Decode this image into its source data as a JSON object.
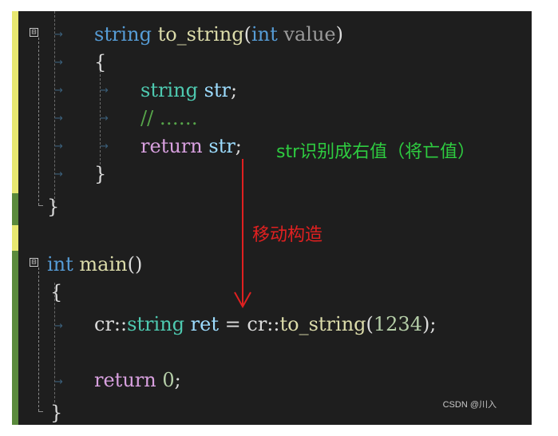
{
  "code_lines": {
    "l1": {
      "kw_string": "string",
      "fn_name": "to_string",
      "lparen": "(",
      "kw_int": "int",
      "param": "value",
      "rparen": ")"
    },
    "l2": {
      "text": "{"
    },
    "l3": {
      "kw_string": "string",
      "var": "str",
      "semi": ";"
    },
    "l4": {
      "comment": "// ……"
    },
    "l5": {
      "kw_return": "return",
      "var": "str",
      "semi": ";"
    },
    "l6": {
      "text": "}"
    },
    "l7": {
      "text": "}"
    },
    "l8": {
      "kw_int": "int",
      "fn_name": "main",
      "parens": "()"
    },
    "l9": {
      "text": "{"
    },
    "l10": {
      "ns1": "cr::",
      "type": "string",
      "var": "ret",
      "eq": "=",
      "ns2": "cr::",
      "fn_name": "to_string",
      "lparen": "(",
      "num": "1234",
      "rparen": ")",
      "semi": ";"
    },
    "l11": {
      "kw_return": "return",
      "num": "0",
      "semi": ";"
    },
    "l12": {
      "text": "}"
    }
  },
  "annotations": {
    "rvalue_note": "str识别成右值（将亡值）",
    "move_construct": "移动构造"
  },
  "watermark": "CSDN @川入",
  "fold_icon": "⊟",
  "colors": {
    "background": "#1e1e1e",
    "keyword": "#569cd6",
    "type": "#4ec9b0",
    "function": "#dcdcaa",
    "identifier": "#9cdcfe",
    "number": "#b5cea8",
    "comment": "#57a64a",
    "control": "#d8a0df",
    "annotation_green": "#2ecc40",
    "annotation_red": "#e02020"
  }
}
